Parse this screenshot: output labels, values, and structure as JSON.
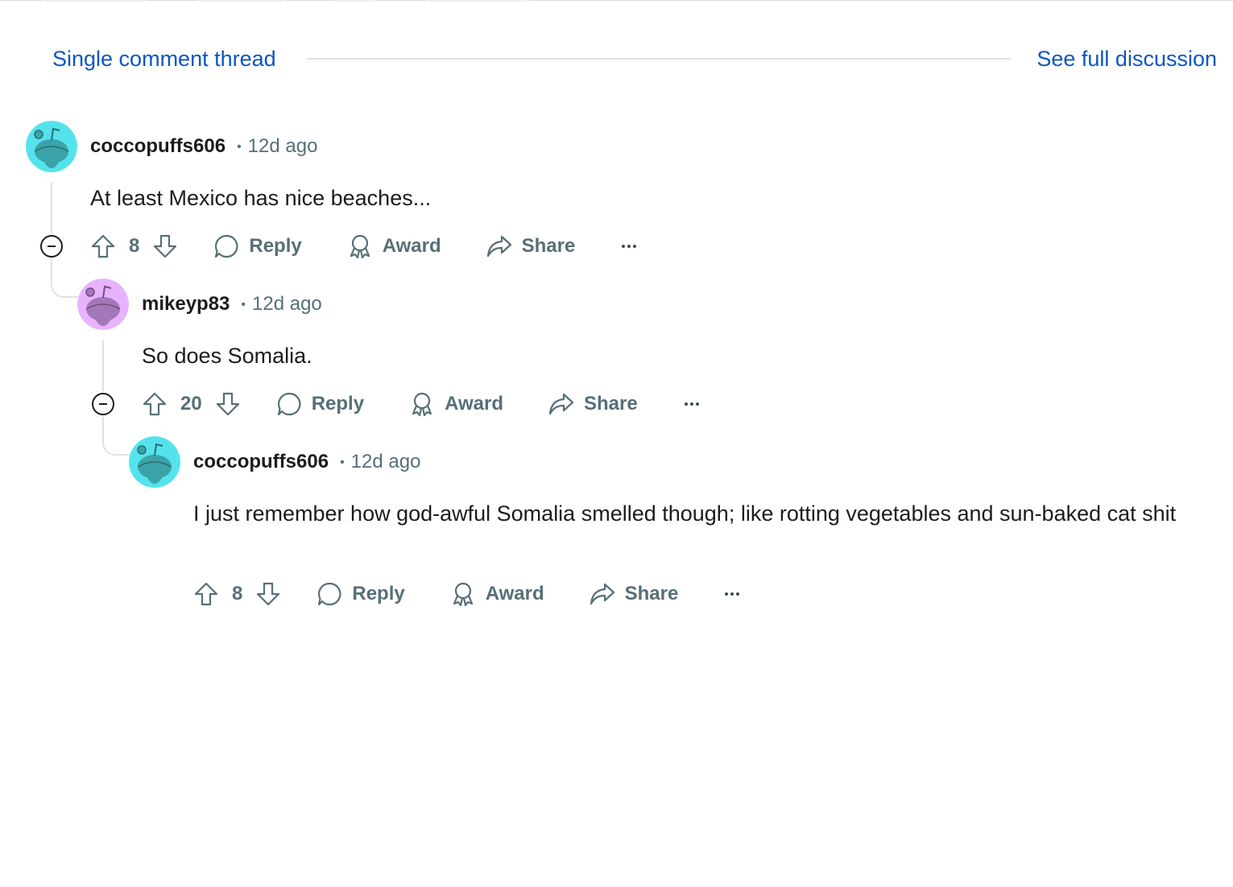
{
  "header": {
    "single_thread_label": "Single comment thread",
    "full_discussion_label": "See full discussion"
  },
  "colors": {
    "link": "#0a56c2",
    "meta_gray": "#576f76",
    "avatar_cyan": "#54e3ed",
    "avatar_pink": "#e7b3ff"
  },
  "comments": [
    {
      "author": "coccopuffs606",
      "time": "12d ago",
      "body": "At least Mexico has nice beaches...",
      "votes": "8",
      "avatar": "snoo-avatar-cyan-icon",
      "actions": {
        "reply": "Reply",
        "award": "Award",
        "share": "Share"
      }
    },
    {
      "author": "mikeyp83",
      "time": "12d ago",
      "body": "So does Somalia.",
      "votes": "20",
      "avatar": "snoo-avatar-pink-icon",
      "actions": {
        "reply": "Reply",
        "award": "Award",
        "share": "Share"
      }
    },
    {
      "author": "coccopuffs606",
      "time": "12d ago",
      "body": "I just remember how god-awful Somalia smelled though; like rotting vegetables and sun-baked cat shit",
      "votes": "8",
      "avatar": "snoo-avatar-cyan-icon",
      "actions": {
        "reply": "Reply",
        "award": "Award",
        "share": "Share"
      }
    }
  ]
}
